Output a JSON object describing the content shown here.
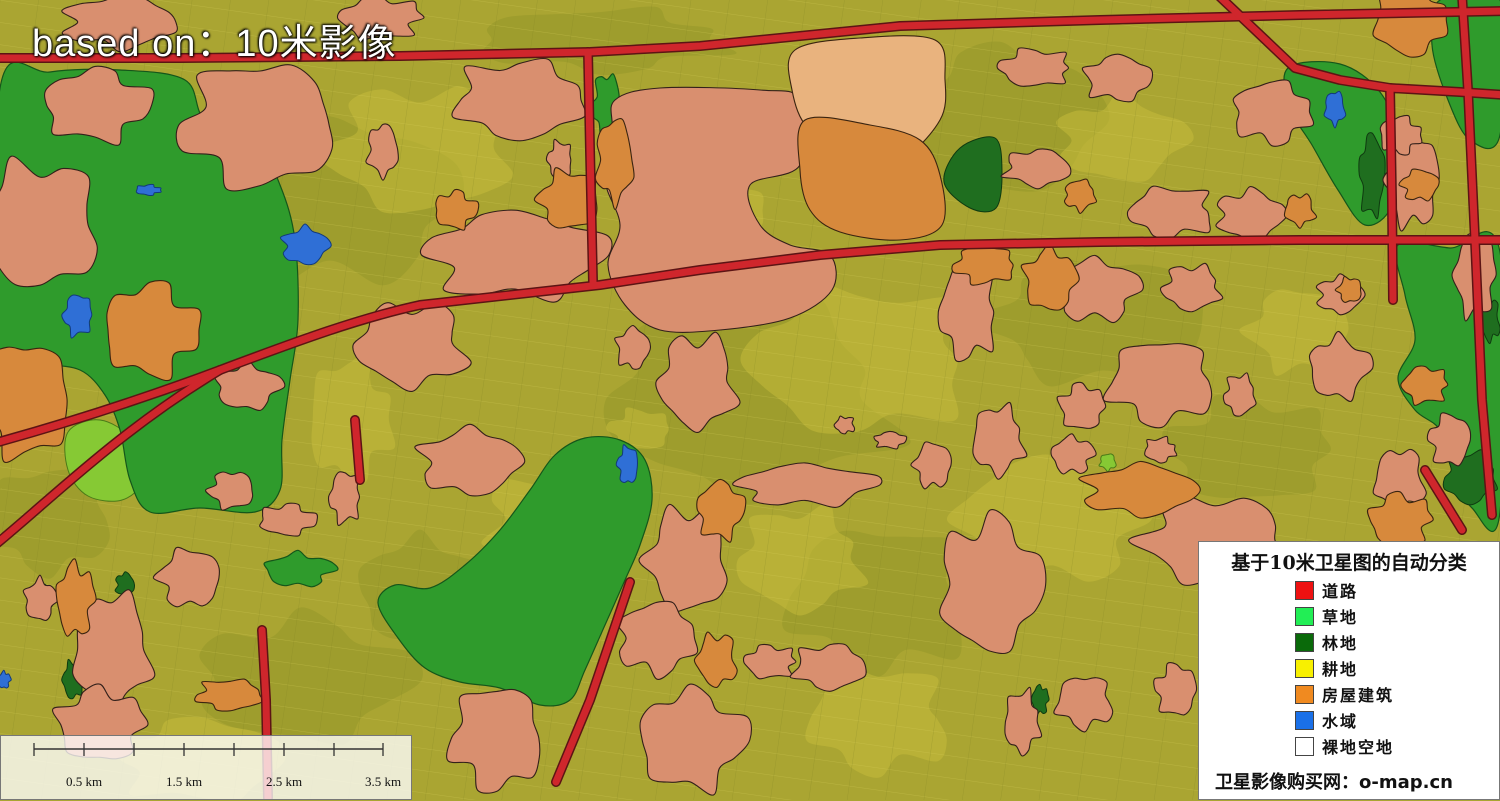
{
  "overlay_title": "based on：10米影像",
  "scale_bar": {
    "labels": [
      "0.5 km",
      "1.5 km",
      "2.5 km",
      "3.5 km"
    ]
  },
  "legend": {
    "title": "基于10米卫星图的自动分类",
    "items": [
      {
        "label": "道路",
        "color": "#ee1111"
      },
      {
        "label": "草地",
        "color": "#22ee55"
      },
      {
        "label": "林地",
        "color": "#0a6a0a"
      },
      {
        "label": "耕地",
        "color": "#f8f000"
      },
      {
        "label": "房屋建筑",
        "color": "#f08a20"
      },
      {
        "label": "水域",
        "color": "#1a70e8"
      },
      {
        "label": "裸地空地",
        "color": "#ffffff"
      }
    ],
    "footer": "卫星影像购买网：o-map.cn"
  }
}
